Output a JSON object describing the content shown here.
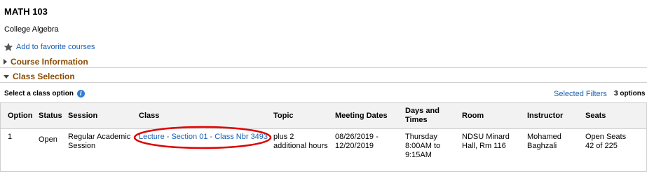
{
  "course": {
    "code": "MATH 103",
    "title": "College Algebra",
    "favorite_label": "Add to favorite courses"
  },
  "sections": {
    "course_information": "Course Information",
    "class_selection": "Class Selection"
  },
  "options_bar": {
    "label": "Select a class option",
    "info_icon": "i",
    "filters_link": "Selected Filters",
    "count": "3 options"
  },
  "table": {
    "headers": {
      "option": "Option",
      "status": "Status",
      "session": "Session",
      "class": "Class",
      "topic": "Topic",
      "meeting_dates": "Meeting Dates",
      "days_times_1": "Days and",
      "days_times_2": "Times",
      "room": "Room",
      "instructor": "Instructor",
      "seats": "Seats"
    },
    "rows": [
      {
        "option": "1",
        "status": "Open",
        "session_1": "Regular Academic",
        "session_2": "Session",
        "class": "Lecture - Section 01 - Class Nbr 3493",
        "topic_1": "plus 2",
        "topic_2": "additional hours",
        "dates_1": "08/26/2019 -",
        "dates_2": "12/20/2019",
        "days_1": "Thursday",
        "days_2": "8:00AM to",
        "days_3": "9:15AM",
        "room_1": "NDSU Minard",
        "room_2": "Hall, Rm 116",
        "instructor_1": "Mohamed",
        "instructor_2": "Baghzali",
        "seats_1": "Open Seats",
        "seats_2": "42 of 225"
      }
    ]
  },
  "colors": {
    "link": "#1a5fb4",
    "section_heading": "#8a4b00",
    "highlight_ellipse": "#e00000"
  },
  "icons": [
    "star-icon",
    "triangle-right-icon",
    "triangle-down-icon",
    "info-icon"
  ]
}
